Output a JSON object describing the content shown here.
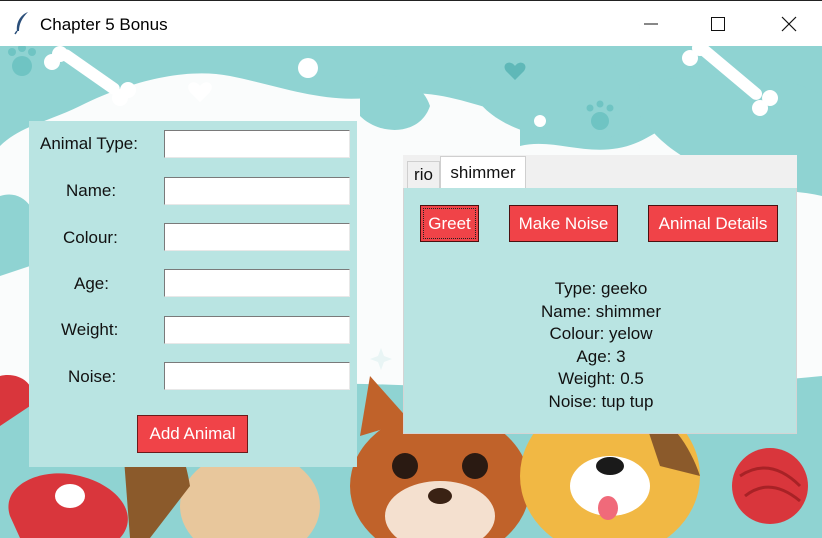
{
  "window": {
    "title": "Chapter 5 Bonus",
    "app_icon": "feather-icon",
    "controls": [
      "minimize-icon",
      "maximize-icon",
      "close-icon"
    ]
  },
  "form": {
    "fields": [
      {
        "label": "Animal Type:",
        "value": ""
      },
      {
        "label": "Name:",
        "value": ""
      },
      {
        "label": "Colour:",
        "value": ""
      },
      {
        "label": "Age:",
        "value": ""
      },
      {
        "label": "Weight:",
        "value": ""
      },
      {
        "label": "Noise:",
        "value": ""
      }
    ],
    "add_button": "Add Animal"
  },
  "notebook": {
    "tabs": [
      {
        "label": "rio",
        "selected": false
      },
      {
        "label": "shimmer",
        "selected": true
      }
    ],
    "buttons": {
      "greet": "Greet",
      "make_noise": "Make Noise",
      "animal_details": "Animal Details"
    },
    "details": [
      "Type: geeko",
      "Name: shimmer",
      "Colour: yelow",
      "Age: 3",
      "Weight: 0.5",
      "Noise: tup tup"
    ]
  },
  "colors": {
    "panel_bg": "#b9e4e2",
    "button_red": "#f04348",
    "button_text": "#ffffff",
    "background_teal": "#8fd3d2"
  }
}
